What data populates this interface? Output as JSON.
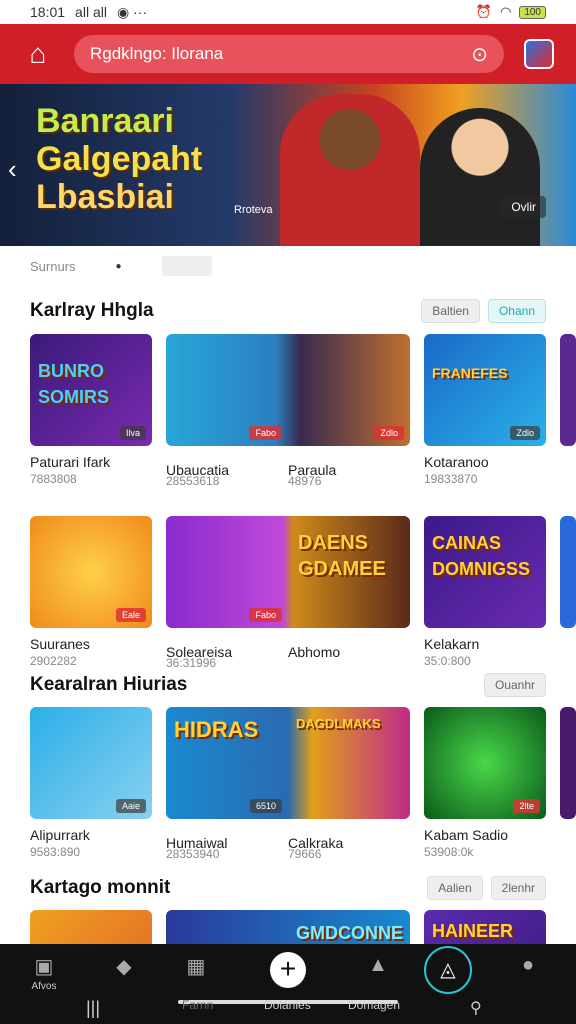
{
  "status": {
    "time": "18:01",
    "signal": "all all",
    "battery": "100"
  },
  "appbar": {
    "search_text": "Rgdklngo: Ilorana"
  },
  "banner": {
    "title_lines": [
      "Banraari",
      "Galgepaht",
      "Lbasbiai"
    ],
    "caption": "Rroteva",
    "pill": "Ovlir"
  },
  "subtabs": {
    "first": "Surnurs"
  },
  "sections": [
    {
      "title": "Karlray Hhgla",
      "btn1": "Baltien",
      "btn2": "Ohann"
    },
    {
      "title": "Kearalran Hiurias",
      "btn1": "Ouanhr"
    },
    {
      "title": "Kartago monnit",
      "btn1": "Aalien",
      "btn2": "2lenhr"
    }
  ],
  "row1": [
    {
      "name": "Paturari Ifark",
      "meta": "7883808",
      "art": "BUNRO SOMIRS",
      "tag": "Ilva"
    },
    {
      "name": "Ubaucatia",
      "meta": "28553618",
      "art": "",
      "tag": "Fabo"
    },
    {
      "name": "Paraula",
      "meta": "48976",
      "art": "",
      "tag": "Zdlo"
    },
    {
      "name": "Kotaranoo",
      "meta": "19833870",
      "art": "FRANEFES",
      "tag": "Zdlo"
    }
  ],
  "row2": [
    {
      "name": "Suuranes",
      "meta": "2902282",
      "art": "",
      "tag": "Eale"
    },
    {
      "name": "Soleareisa",
      "meta": "36:31996",
      "art": "",
      "tag": "Fabo"
    },
    {
      "name": "Abhomo",
      "meta": "",
      "art": "DAENS GDAMEE",
      "tag": ""
    },
    {
      "name": "Kelakarn",
      "meta": "35:0:800",
      "art": "CAINAS DOMNIGSS",
      "tag": ""
    }
  ],
  "row3": [
    {
      "name": "Alipurrark",
      "meta": "9583:890",
      "art": "",
      "tag": "Aaie"
    },
    {
      "name": "Humaiwal",
      "meta": "28353940",
      "art": "HIDRAS",
      "tag": "6510"
    },
    {
      "name": "Calkraka",
      "meta": "79666",
      "art": "DAGDLMAKS",
      "tag": ""
    },
    {
      "name": "Kabam Sadio",
      "meta": "53908:0k",
      "art": "",
      "tag": "2lte"
    }
  ],
  "row4": [
    {
      "art": ""
    },
    {
      "art": "GMDCONNE"
    },
    {
      "art": "HAINEER"
    }
  ],
  "bottomnav": {
    "first_label": "Afvos",
    "labels": [
      "Farnn",
      "Dolanles",
      "Domagen"
    ]
  },
  "colors": {
    "accent": "#d11f2a",
    "teal": "#27c4d4"
  }
}
